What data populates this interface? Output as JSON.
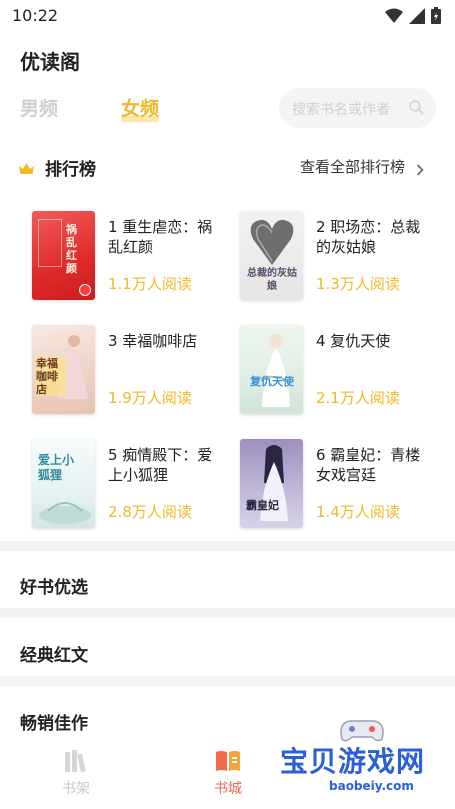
{
  "status_bar": {
    "time": "10:22"
  },
  "app": {
    "title": "优读阁"
  },
  "tabs": [
    {
      "label": "男频",
      "selected": false
    },
    {
      "label": "女频",
      "selected": true
    }
  ],
  "search": {
    "placeholder": "搜索书名或作者"
  },
  "ranking": {
    "title": "排行榜",
    "more_label": "查看全部排行榜",
    "books": [
      {
        "title": "1 重生虐恋：祸乱红颜",
        "reads": "1.1万人阅读",
        "cover_text": "祸乱红颜"
      },
      {
        "title": "2 职场恋：总裁的灰姑娘",
        "reads": "1.3万人阅读",
        "cover_text": "总裁的灰姑娘"
      },
      {
        "title": "3 幸福咖啡店",
        "reads": "1.9万人阅读",
        "cover_text": "幸福咖啡店"
      },
      {
        "title": "4 复仇天使",
        "reads": "2.1万人阅读",
        "cover_text": "复仇天使"
      },
      {
        "title": "5 痴情殿下：爱上小狐狸",
        "reads": "2.8万人阅读",
        "cover_text": "爱上小狐狸"
      },
      {
        "title": "6 霸皇妃：青楼女戏宫廷",
        "reads": "1.4万人阅读",
        "cover_text": "霸皇妃"
      }
    ]
  },
  "sections": [
    "好书优选",
    "经典红文",
    "畅销佳作"
  ],
  "bottom_nav": [
    {
      "label": "书架",
      "icon": "bookshelf-icon",
      "active": false
    },
    {
      "label": "书城",
      "icon": "bookstore-icon",
      "active": true
    }
  ],
  "watermark": {
    "text": "宝贝游戏网",
    "url": "baobeiy.com"
  },
  "colors": {
    "accent": "#f1b829",
    "muted": "#cfcfcf",
    "divider": "#f3f3f3"
  }
}
